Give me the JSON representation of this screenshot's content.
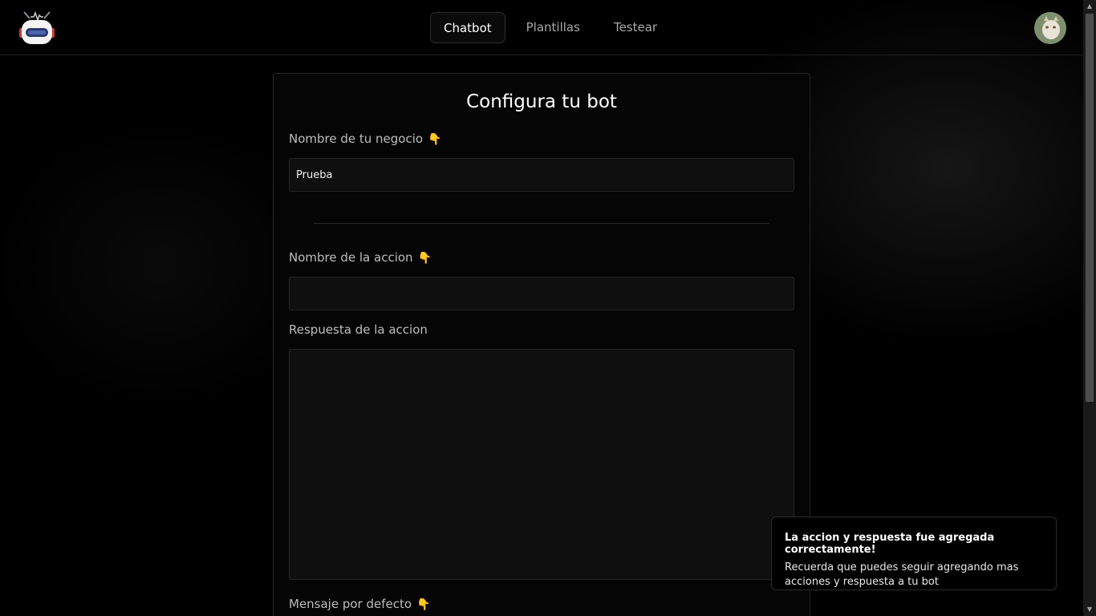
{
  "header": {
    "nav": [
      {
        "label": "Chatbot",
        "active": true
      },
      {
        "label": "Plantillas",
        "active": false
      },
      {
        "label": "Testear",
        "active": false
      }
    ]
  },
  "form": {
    "title": "Configura tu bot",
    "business_name": {
      "label": "Nombre de tu negocio",
      "value": "Prueba",
      "icon": "pointing-down-icon"
    },
    "action_name": {
      "label": "Nombre de la accion",
      "value": "",
      "icon": "pointing-down-icon"
    },
    "action_response": {
      "label": "Respuesta de la accion",
      "value": ""
    },
    "default_message": {
      "label": "Mensaje por defecto",
      "icon": "pointing-down-icon"
    }
  },
  "toast": {
    "title": "La accion y respuesta fue agregada correctamente!",
    "description": "Recuerda que puedes seguir agregando mas acciones y respuesta a tu bot"
  },
  "colors": {
    "background": "#000000",
    "accent_emoji": "#c9982e",
    "card_border": "#262626"
  }
}
